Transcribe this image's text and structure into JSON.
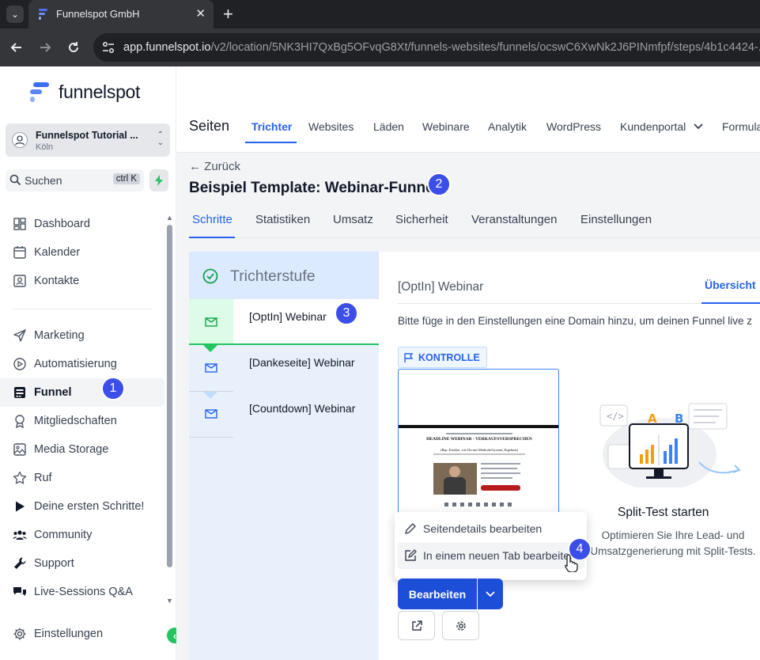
{
  "browser": {
    "tab_title": "Funnelspot GmbH",
    "url_host": "app.funnelspot.io",
    "url_path": "/v2/location/5NK3HI7QxBg5OFvqG8Xt/funnels-websites/funnels/ocswC6XwNk2J6PINmfpf/steps/4b1c4424-..."
  },
  "sidebar": {
    "logo_text": "funnelspot",
    "account_name": "Funnelspot Tutorial ...",
    "account_location": "Köln",
    "search_placeholder": "Suchen",
    "search_shortcut": "ctrl K",
    "items": [
      {
        "label": "Dashboard"
      },
      {
        "label": "Kalender"
      },
      {
        "label": "Kontakte"
      },
      {
        "label": "Marketing"
      },
      {
        "label": "Automatisierung"
      },
      {
        "label": "Funnel"
      },
      {
        "label": "Mitgliedschaften"
      },
      {
        "label": "Media Storage"
      },
      {
        "label": "Ruf"
      },
      {
        "label": "Deine ersten Schritte!"
      },
      {
        "label": "Community"
      },
      {
        "label": "Support"
      },
      {
        "label": "Live-Sessions Q&A"
      }
    ],
    "settings_label": "Einstellungen"
  },
  "annotations": {
    "n1": "1",
    "n2": "2",
    "n3": "3",
    "n4": "4"
  },
  "topnav": {
    "title": "Seiten",
    "tabs": [
      "Trichter",
      "Websites",
      "Läden",
      "Webinare",
      "Analytik",
      "WordPress",
      "Kundenportal",
      "Formula"
    ]
  },
  "funnel": {
    "back_label": "← Zurück",
    "title": "Beispiel Template: Webinar-Funnel",
    "tabs": [
      "Schritte",
      "Statistiken",
      "Umsatz",
      "Sicherheit",
      "Veranstaltungen",
      "Einstellungen"
    ]
  },
  "steps": {
    "header": "Trichterstufe",
    "items": [
      {
        "label": "[OptIn] Webinar"
      },
      {
        "label": "[Dankeseite] Webinar"
      },
      {
        "label": "[Countdown] Webinar"
      }
    ]
  },
  "detail": {
    "title": "[OptIn] Webinar",
    "tab": "Übersicht",
    "note": "Bitte füge in den Einstellungen eine Domain hinzu, um deinen Funnel live z",
    "variant_badge": "KONTROLLE",
    "preview": {
      "headline": "HEADLINE WEBINAR - VERKAUFSVERSPRECHEN",
      "subheadline": "(Bsp. Erfahre, wie Du mit Methode/System, Ergebnis)"
    },
    "split_title": "Split-Test starten",
    "split_desc": "Optimieren Sie Ihre Lead- und Umsatzgenerierung mit Split-Tests.",
    "menu": [
      "Seitendetails bearbeiten",
      "In einem neuen Tab bearbeiten"
    ],
    "edit_button": "Bearbeiten"
  },
  "colors": {
    "accent": "#2563eb",
    "annotation": "#3b4ee8",
    "success": "#22c55e"
  }
}
